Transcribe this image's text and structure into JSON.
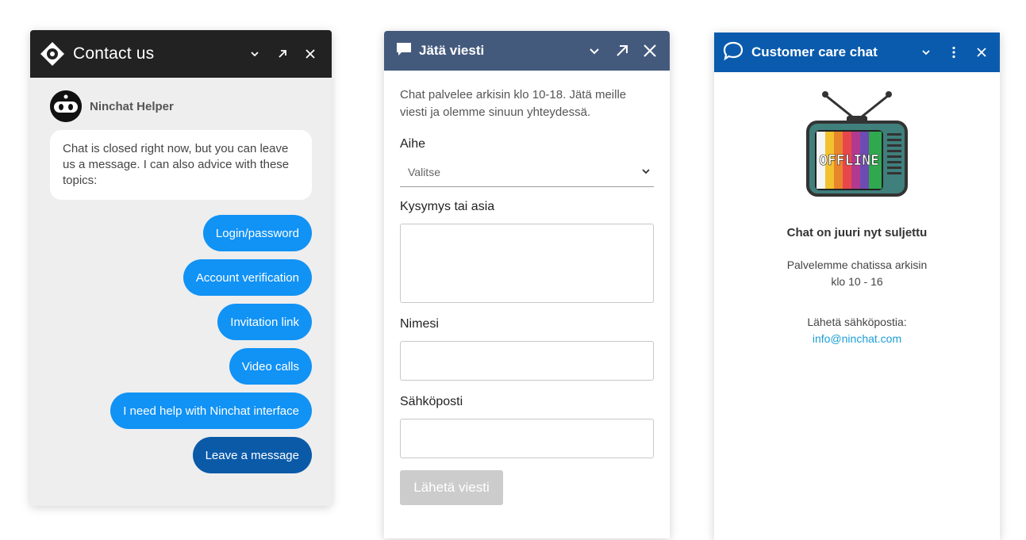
{
  "colors": {
    "w1_header": "#222222",
    "w1_bg": "#eeeeee",
    "option_blue": "#1192f5",
    "option_dark_blue": "#0a5aa8",
    "w2_header": "#445a7d",
    "w3_header": "#0a5bad",
    "link": "#1b9fd6",
    "send_disabled": "#cccccc"
  },
  "widget1": {
    "title": "Contact us",
    "header_icons": [
      "minimize-chevron-icon",
      "popout-arrow-icon",
      "close-icon"
    ],
    "agent_name": "Ninchat Helper",
    "message": "Chat is closed right now, but you can leave us a message. I can also advice with these topics:",
    "options": [
      "Login/password",
      "Account verification",
      "Invitation link",
      "Video calls",
      "I need help with Ninchat interface",
      "Leave a message"
    ]
  },
  "widget2": {
    "title": "Jätä viesti",
    "intro": "Chat palvelee arkisin klo 10-18. Jätä meille viesti ja olemme sinuun yhteydessä.",
    "subject_label": "Aihe",
    "subject_placeholder": "Valitse",
    "question_label": "Kysymys tai asia",
    "name_label": "Nimesi",
    "email_label": "Sähköposti",
    "send_label": "Lähetä viesti"
  },
  "widget3": {
    "title": "Customer care chat",
    "tv_text": "OFFLINE",
    "closed_text": "Chat on juuri nyt suljettu",
    "hours_line1": "Palvelemme chatissa arkisin",
    "hours_line2": "klo 10 - 16",
    "email_prompt": "Lähetä sähköpostia:",
    "email": "info@ninchat.com"
  }
}
